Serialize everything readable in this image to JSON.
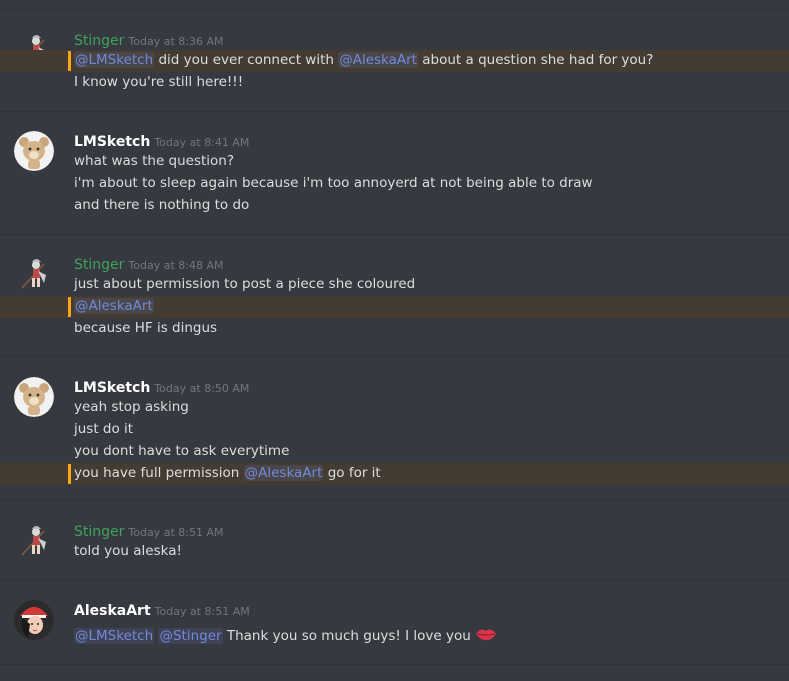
{
  "colors": {
    "background": "#36393f",
    "divider": "#2f3136",
    "text": "#dcddde",
    "timestamp": "#72767d",
    "mention": "#7289da",
    "highlight_bar": "#faa61a",
    "stinger_name": "#3fa25b"
  },
  "messages": [
    {
      "username": "Stinger",
      "timestamp": "Today at 8:36 AM",
      "avatar_icon": "stinger-avatar",
      "lines": [
        {
          "pre": "",
          "mention": "@LMSketch",
          "mid": " did you ever connect with ",
          "mention2": "@AleskaArt",
          "post": " about a question she had for you?"
        },
        {
          "text": "I know you're still here!!!"
        }
      ]
    },
    {
      "username": "LMSketch",
      "timestamp": "Today at 8:41 AM",
      "avatar_icon": "bear-avatar",
      "lines": [
        "what was the question?",
        "i'm about to sleep again because i'm too annoyerd at not being able to draw",
        "and there is nothing to do"
      ]
    },
    {
      "username": "Stinger",
      "timestamp": "Today at 8:48 AM",
      "avatar_icon": "stinger-avatar",
      "lines": [
        "just about permission to post a piece she coloured",
        "@AleskaArt",
        "because HF is dingus"
      ]
    },
    {
      "username": "LMSketch",
      "timestamp": "Today at 8:50 AM",
      "avatar_icon": "bear-avatar",
      "lines": [
        "yeah stop asking",
        "just do it",
        "you dont have to ask everytime",
        {
          "pre": "you have full permission ",
          "mention": "@AleskaArt",
          "post": " go for it"
        }
      ]
    },
    {
      "username": "Stinger",
      "timestamp": "Today at 8:51 AM",
      "avatar_icon": "stinger-avatar",
      "lines": [
        "told you aleska!"
      ]
    },
    {
      "username": "AleskaArt",
      "timestamp": "Today at 8:51 AM",
      "avatar_icon": "aleska-avatar",
      "lines": [
        {
          "mention": "@LMSketch",
          "mention2": "@Stinger",
          "post": " Thank you so much guys! I love you",
          "emoji": "kiss-lips-icon"
        }
      ]
    }
  ]
}
